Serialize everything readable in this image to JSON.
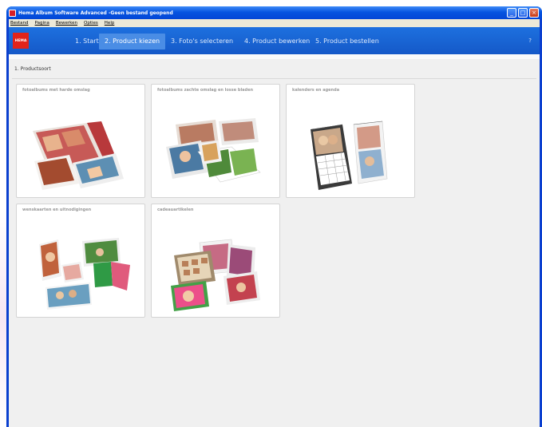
{
  "window": {
    "title": "Hema Album Software Advanced -Geen bestand geopend",
    "minimize_glyph": "_",
    "maximize_glyph": "□",
    "close_glyph": "×"
  },
  "menu": [
    "Bestand",
    "Pagina",
    "Bewerken",
    "Opties",
    "Help"
  ],
  "logo_text": "HEMA",
  "steps": [
    {
      "label": "1. Start",
      "active": false
    },
    {
      "label": "2. Product kiezen",
      "active": true
    },
    {
      "label": "3. Foto's selecteren",
      "active": false
    },
    {
      "label": "4. Product bewerken",
      "active": false
    },
    {
      "label": "5. Product bestellen",
      "active": false
    }
  ],
  "help_label": "?",
  "section_title": "1. Productsoort",
  "products": [
    {
      "title": "fotoalbums met harde omslag",
      "icon": "hardcover-photobook-icon"
    },
    {
      "title": "fotoalbums zachte omslag en losse bladen",
      "icon": "softcover-photobook-icon"
    },
    {
      "title": "kalenders en agenda",
      "icon": "calendar-icon"
    },
    {
      "title": "wenskaarten en uitnodigingen",
      "icon": "greeting-card-icon"
    },
    {
      "title": "cadeauartikelen",
      "icon": "gift-items-icon"
    }
  ],
  "colors": {
    "nav_bar": "#1559c8",
    "active_step": "#4a8de5",
    "logo": "#e2231a",
    "content_bg": "#f0f0f0"
  }
}
